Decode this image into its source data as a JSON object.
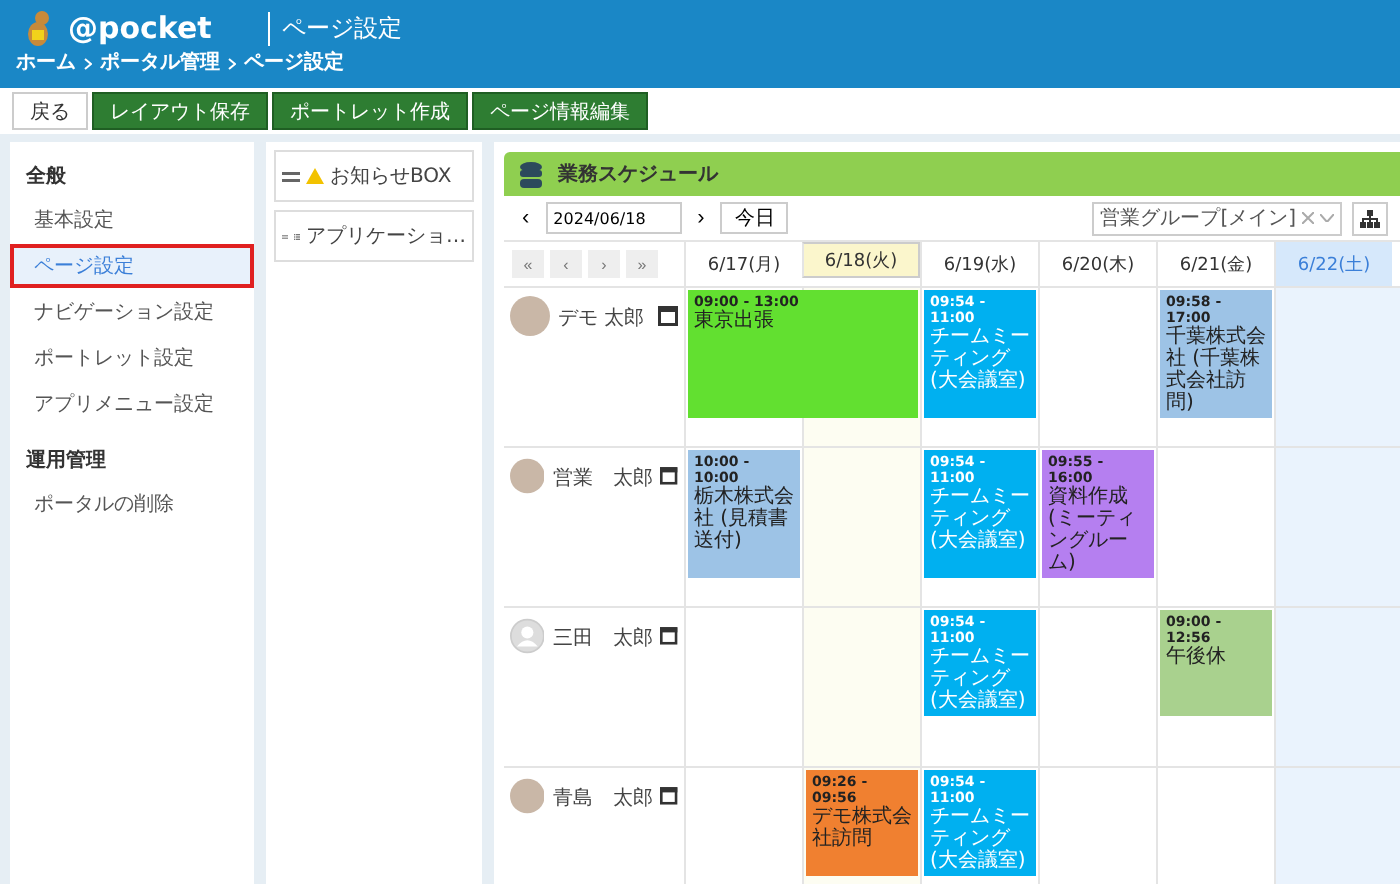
{
  "header": {
    "logo": "@pocket",
    "title": "ページ設定",
    "breadcrumb": [
      "ホーム",
      "ポータル管理",
      "ページ設定"
    ]
  },
  "toolbar": [
    {
      "label": "戻る",
      "kind": "plain"
    },
    {
      "label": "レイアウト保存",
      "kind": "primary"
    },
    {
      "label": "ポートレット作成",
      "kind": "primary"
    },
    {
      "label": "ページ情報編集",
      "kind": "primary"
    }
  ],
  "sidebar": [
    {
      "heading": "全般",
      "items": [
        {
          "label": "基本設定",
          "selected": false
        },
        {
          "label": "ページ設定",
          "selected": true
        },
        {
          "label": "ナビゲーション設定",
          "selected": false
        },
        {
          "label": "ポートレット設定",
          "selected": false
        },
        {
          "label": "アプリメニュー設定",
          "selected": false
        }
      ]
    },
    {
      "heading": "運用管理",
      "items": [
        {
          "label": "ポータルの削除",
          "selected": false
        }
      ]
    }
  ],
  "palette": [
    {
      "label": "お知らせBOX",
      "kind": "notice"
    },
    {
      "label": "アプリケーショ…",
      "kind": "list"
    }
  ],
  "schedule": {
    "title": "業務スケジュール",
    "date": "2024/06/18",
    "prev": "‹",
    "next": "›",
    "today_button": "今日",
    "group": "営業グループ[メイン]",
    "nav": [
      "«",
      "‹",
      "›",
      "»"
    ],
    "days": [
      {
        "label": "6/17(月)",
        "kind": "weekday"
      },
      {
        "label": "6/18(火)",
        "kind": "today"
      },
      {
        "label": "6/19(水)",
        "kind": "weekday"
      },
      {
        "label": "6/20(木)",
        "kind": "weekday"
      },
      {
        "label": "6/21(金)",
        "kind": "weekday"
      },
      {
        "label": "6/22(土)",
        "kind": "saturday"
      }
    ],
    "users": [
      {
        "name": "デモ 太郎",
        "kind": "photo",
        "cells": [
          {
            "kind": "event",
            "time": "09:00 - 13:00",
            "title": "東京出張",
            "color": "#62e030",
            "light_text": false,
            "continues": true
          },
          {
            "kind": "empty"
          },
          {
            "kind": "event",
            "time": "09:54 - 11:00",
            "title": "チームミーティング (大会議室)",
            "color": "#00b0f0",
            "light_text": true,
            "continues": false
          },
          {
            "kind": "empty"
          },
          {
            "kind": "event",
            "time": "09:58 - 17:00",
            "title": "千葉株式会社 (千葉株式会社訪問)",
            "color": "#9dc3e6",
            "light_text": false,
            "continues": false
          },
          {
            "kind": "empty"
          }
        ]
      },
      {
        "name": "営業　太郎",
        "kind": "photo",
        "cells": [
          {
            "kind": "event",
            "time": "10:00 - 10:00",
            "title": "栃木株式会社 (見積書送付)",
            "color": "#9dc3e6",
            "light_text": false,
            "continues": false
          },
          {
            "kind": "empty"
          },
          {
            "kind": "event",
            "time": "09:54 - 11:00",
            "title": "チームミーティング (大会議室)",
            "color": "#00b0f0",
            "light_text": true,
            "continues": false
          },
          {
            "kind": "event",
            "time": "09:55 - 16:00",
            "title": "資料作成 (ミーティングルーム)",
            "color": "#b57ff0",
            "light_text": false,
            "continues": false
          },
          {
            "kind": "empty"
          },
          {
            "kind": "empty"
          }
        ]
      },
      {
        "name": "三田　太郎",
        "kind": "silhouette",
        "cells": [
          {
            "kind": "empty"
          },
          {
            "kind": "empty"
          },
          {
            "kind": "event",
            "time": "09:54 - 11:00",
            "title": "チームミーティング (大会議室)",
            "color": "#00b0f0",
            "light_text": true,
            "continues": false
          },
          {
            "kind": "empty"
          },
          {
            "kind": "event",
            "time": "09:00 - 12:56",
            "title": "午後休",
            "color": "#a9d18e",
            "light_text": false,
            "continues": false
          },
          {
            "kind": "empty"
          }
        ]
      },
      {
        "name": "青島　太郎",
        "kind": "photo",
        "cells": [
          {
            "kind": "empty"
          },
          {
            "kind": "event",
            "time": "09:26 - 09:56",
            "title": "デモ株式会社訪問",
            "color": "#f08030",
            "light_text": false,
            "continues": false
          },
          {
            "kind": "event",
            "time": "09:54 - 11:00",
            "title": "チームミーティング (大会議室)",
            "color": "#00b0f0",
            "light_text": true,
            "continues": false
          },
          {
            "kind": "empty"
          },
          {
            "kind": "empty"
          },
          {
            "kind": "empty"
          }
        ]
      }
    ]
  }
}
